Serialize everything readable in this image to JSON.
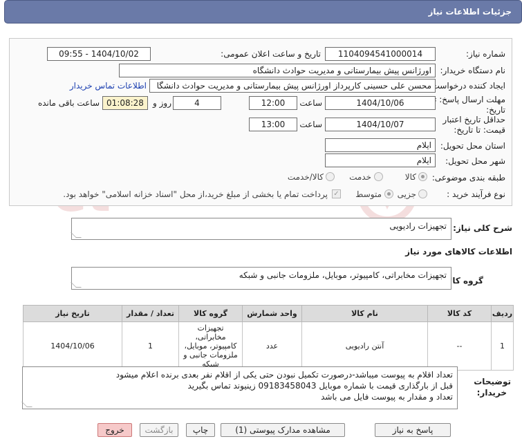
{
  "header": {
    "title": "جزئیات اطلاعات نیاز"
  },
  "form": {
    "need_number_label": "شماره نیاز:",
    "need_number": "1104094541000014",
    "announce_label": "تاریخ و ساعت اعلان عمومی:",
    "announce_value": "1404/10/02 - 09:55",
    "buyer_label": "نام دستگاه خریدار:",
    "buyer_value": "اورژانس پیش بیمارستانی و مدیریت حوادث دانشگاه",
    "creator_label": "ایجاد کننده درخواست:",
    "creator_value": "محسن علی حسینی کارپرداز اورژانس پیش بیمارستانی و مدیریت حوادث دانشگا",
    "contact_link": "اطلاعات تماس خریدار",
    "deadline_label_1": "مهلت ارسال پاسخ: تا",
    "deadline_label_2": "تاریخ:",
    "deadline_date": "1404/10/06",
    "time_label": "ساعت",
    "deadline_time": "12:00",
    "days_value": "4",
    "days_label": "روز و",
    "remaining_value": "01:08:28",
    "remaining_label": "ساعت باقی مانده",
    "validity_label_1": "حداقل تاریخ اعتبار",
    "validity_label_2": "قیمت: تا تاریخ:",
    "validity_date": "1404/10/07",
    "validity_time": "13:00",
    "province_label": "استان محل تحویل:",
    "province_value": "ایلام",
    "city_label": "شهر محل تحویل:",
    "city_value": "ایلام",
    "category_label": "طبقه بندی موضوعی:",
    "category_options": [
      "کالا",
      "خدمت",
      "کالا/خدمت"
    ],
    "purchase_label": "نوع فرآیند خرید :",
    "purchase_options": [
      "جزیی",
      "متوسط"
    ],
    "payment_note": "پرداخت تمام یا بخشی از مبلغ خرید،از محل \"اسناد خزانه اسلامی\" خواهد بود."
  },
  "summary": {
    "label": "شرح کلی نیاز:",
    "value": "تجهیزات رادیویی"
  },
  "goods": {
    "section_title": "اطلاعات کالاهای مورد نیاز",
    "group_label": "گروه کالا:",
    "group_value": "تجهیزات مخابراتی، کامپیوتر، موبایل، ملزومات جانبی و شبکه"
  },
  "table": {
    "headers": [
      "ردیف",
      "کد کالا",
      "نام کالا",
      "واحد شمارش",
      "گروه کالا",
      "تعداد / مقدار",
      "تاریخ نیاز"
    ],
    "rows": [
      {
        "row": "1",
        "code": "--",
        "name": "آنتن رادیویی",
        "unit": "عدد",
        "group": "تجهیزات مخابراتی، کامپیوتر، موبایل، ملزومات جانبی و شبکه",
        "qty": "1",
        "date": "1404/10/06"
      }
    ]
  },
  "notes": {
    "label_1": "توضیحات",
    "label_2": "خریدار:",
    "line1": "تعداد اقلام به پیوست میباشد-درصورت تکمیل نبودن حتی یکی از اقلام نفر بعدی برنده اعلام میشود",
    "line2": "قبل از بارگذاری قیمت با شماره موبایل 09183458043 زینیوند تماس بگیرید",
    "line3": "تعداد و مقدار به پیوست فایل می باشد"
  },
  "buttons": {
    "reply": "پاسخ به نیاز",
    "attachments": "مشاهده مدارک پیوستی (1)",
    "print": "چاپ",
    "back": "بازگشت",
    "exit": "خروج"
  },
  "watermark": {
    "text": "AriaTender.net"
  }
}
